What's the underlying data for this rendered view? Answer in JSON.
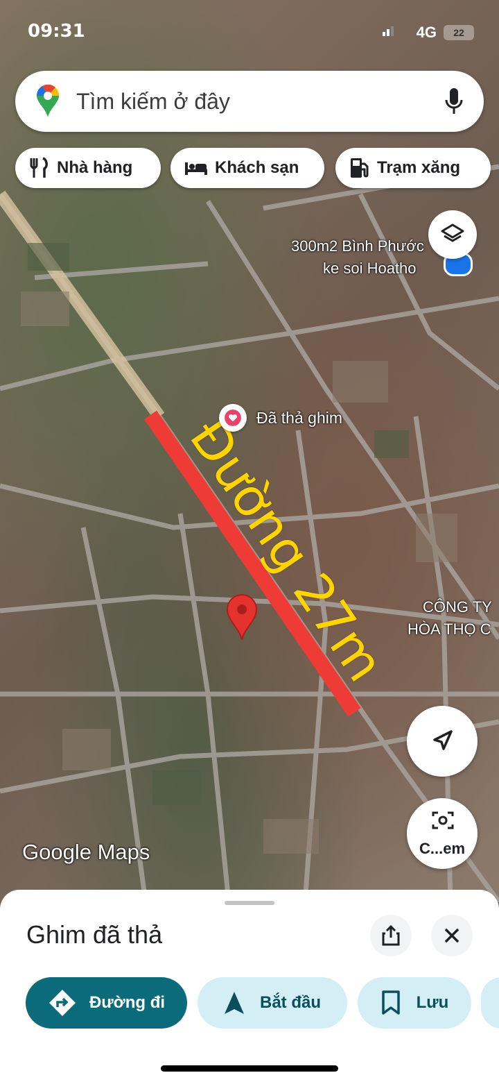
{
  "status_bar": {
    "time": "09:31",
    "network": "4G",
    "battery": "22"
  },
  "search": {
    "placeholder": "Tìm kiếm ở đây"
  },
  "chips": [
    {
      "label": "Nhà hàng",
      "icon": "restaurant-icon"
    },
    {
      "label": "Khách sạn",
      "icon": "hotel-icon"
    },
    {
      "label": "Trạm xăng",
      "icon": "gas-station-icon"
    }
  ],
  "map": {
    "place_label_line1": "300m2 Bình Phước",
    "place_label_line2": "ke soi Hoatho",
    "pinned_label": "Đã thả ghim",
    "company_line1": "CÔNG TY",
    "company_line2": "HÒA THỌ C",
    "annotation": "Đường 27m",
    "attribution": "Google Maps",
    "camera_label": "C...em",
    "road_color": "#ef3b36",
    "annotation_color": "#ffd400"
  },
  "sheet": {
    "title": "Ghim đã thả",
    "actions": [
      {
        "label": "Đường đi",
        "icon": "directions-icon"
      },
      {
        "label": "Bắt đầu",
        "icon": "navigation-arrow-icon"
      },
      {
        "label": "Lưu",
        "icon": "bookmark-icon"
      }
    ],
    "accent": "#0b6b7a"
  }
}
